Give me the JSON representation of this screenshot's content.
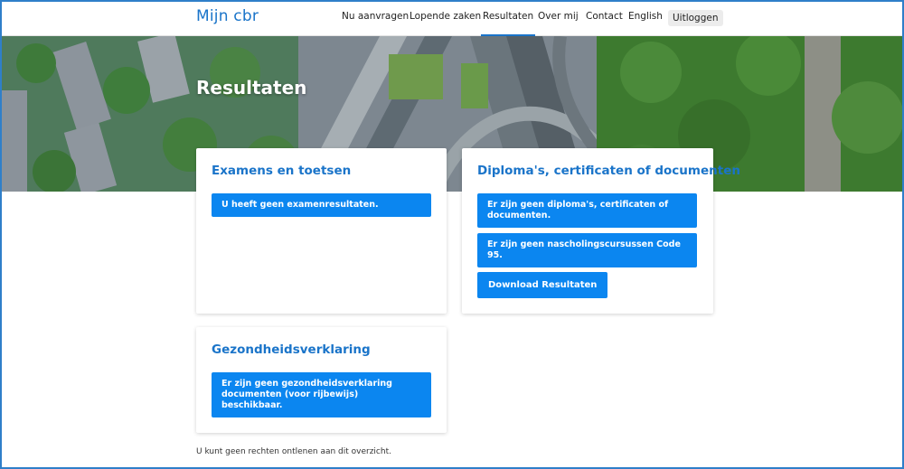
{
  "header": {
    "brand": "Mijn cbr",
    "nav": [
      "Nu aanvragen",
      "Lopende zaken",
      "Resultaten",
      "Over mij",
      "Contact",
      "English"
    ],
    "active": "Resultaten",
    "logout": "Uitloggen"
  },
  "hero": {
    "title": "Resultaten"
  },
  "cards": {
    "exams": {
      "title": "Examens en toetsen",
      "notice": "U heeft geen examenresultaten."
    },
    "diplomas": {
      "title": "Diploma's, certificaten of documenten",
      "notice1": "Er zijn geen diploma's, certificaten of documenten.",
      "notice2": "Er zijn geen nascholingscursussen Code 95.",
      "button": "Download Resultaten"
    },
    "health": {
      "title": "Gezondheidsverklaring",
      "notice": "Er zijn geen gezondheidsverklaring documenten (voor rijbewijs) beschikbaar."
    }
  },
  "footer": {
    "disclaimer": "U kunt geen rechten ontlenen aan dit overzicht."
  },
  "colors": {
    "accent": "#1a74c9",
    "notice": "#0b86f0"
  }
}
